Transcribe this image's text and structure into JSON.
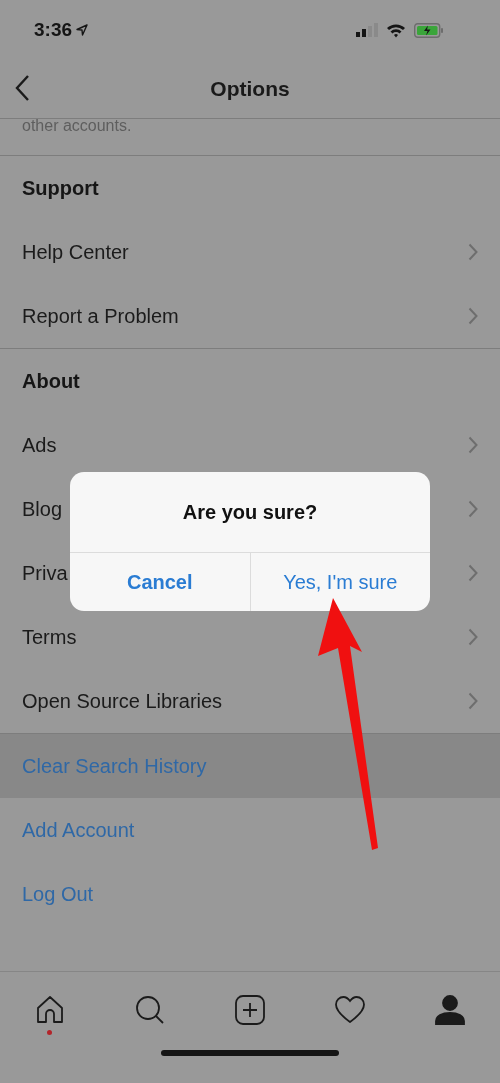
{
  "status_bar": {
    "time": "3:36"
  },
  "nav": {
    "title": "Options"
  },
  "note": "other accounts.",
  "sections": [
    {
      "header": "Support",
      "rows": [
        {
          "label": "Help Center",
          "kind": "nav",
          "selected": false
        },
        {
          "label": "Report a Problem",
          "kind": "nav",
          "selected": false
        }
      ]
    },
    {
      "header": "About",
      "rows": [
        {
          "label": "Ads",
          "kind": "nav",
          "selected": false
        },
        {
          "label": "Blog",
          "kind": "nav",
          "selected": false
        },
        {
          "label": "Priva",
          "kind": "nav",
          "selected": false
        },
        {
          "label": "Terms",
          "kind": "nav",
          "selected": false
        },
        {
          "label": "Open Source Libraries",
          "kind": "nav",
          "selected": false
        }
      ]
    },
    {
      "rows": [
        {
          "label": "Clear Search History",
          "kind": "action",
          "selected": true
        },
        {
          "label": "Add Account",
          "kind": "action",
          "selected": false
        },
        {
          "label": "Log Out",
          "kind": "action",
          "selected": false
        }
      ]
    }
  ],
  "dialog": {
    "title": "Are you sure?",
    "buttons": [
      {
        "label": "Cancel",
        "kind": "cancel"
      },
      {
        "label": "Yes, I'm sure",
        "kind": "default"
      }
    ]
  },
  "tab_bar": [
    {
      "kind": "home",
      "selected": false,
      "notification": true
    },
    {
      "kind": "search",
      "selected": false,
      "notification": false
    },
    {
      "kind": "add",
      "selected": false,
      "notification": false
    },
    {
      "kind": "heart",
      "selected": false,
      "notification": false
    },
    {
      "kind": "profile",
      "selected": true,
      "notification": false
    }
  ]
}
